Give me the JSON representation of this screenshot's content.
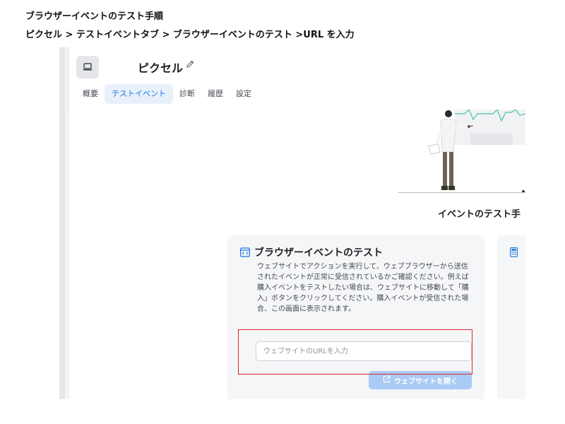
{
  "doc": {
    "title": "ブラウザーイベントのテスト手順",
    "path": "ピクセル > テストイベントタブ > ブラウザーイベントのテスト >URL を入力"
  },
  "app": {
    "icon": "laptop-icon",
    "page_title": "ピクセル",
    "edit_icon": "pencil-icon",
    "tabs": [
      {
        "label": "概要",
        "active": false
      },
      {
        "label": "テストイベント",
        "active": true
      },
      {
        "label": "診断",
        "active": false
      },
      {
        "label": "履歴",
        "active": false
      },
      {
        "label": "設定",
        "active": false
      }
    ]
  },
  "main": {
    "section_title": "イベントのテスト手",
    "card": {
      "icon": "browser-code-icon",
      "title": "ブラウザーイベントのテスト",
      "description": "ウェブサイトでアクションを実行して、ウェブブラウザーから送信されたイベントが正常に受信されているかご確認ください。例えば購入イベントをテストしたい場合は、ウェブサイトに移動して「購入」ボタンをクリックしてください。購入イベントが受信された場合、この画面に表示されます。",
      "url_input": {
        "value": "",
        "placeholder": "ウェブサイトのURLを入力"
      },
      "open_button": {
        "label": "ウェブサイトを開く",
        "icon": "external-link-icon"
      }
    },
    "side_card": {
      "icon": "calculator-icon"
    }
  },
  "colors": {
    "accent": "#1b74e4",
    "tab_active_bg": "#e7f0fb",
    "button_disabled": "#a9cbf5",
    "highlight": "#e0262d",
    "teal": "#5ec9b0"
  }
}
